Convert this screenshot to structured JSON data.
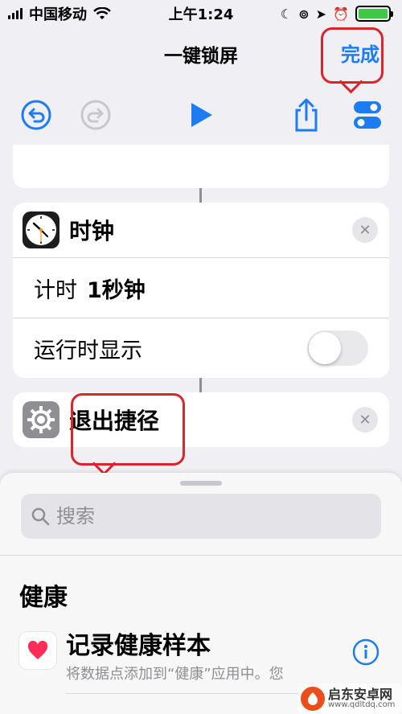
{
  "status_bar": {
    "carrier": "中国移动",
    "time": "上午1:24",
    "battery_level": 1.0
  },
  "nav": {
    "title": "一键锁屏",
    "done_label": "完成"
  },
  "toolbar": {
    "icons": [
      "undo-icon",
      "redo-icon",
      "play-icon",
      "share-icon",
      "settings-toggle-icon"
    ]
  },
  "actions": {
    "clock": {
      "title": "时钟",
      "timer_prefix": "计时",
      "timer_value": "1秒钟",
      "show_when_run_label": "运行时显示",
      "show_when_run": false
    },
    "exit": {
      "title": "退出捷径"
    }
  },
  "sheet": {
    "search_placeholder": "搜索",
    "section_title": "健康",
    "item": {
      "title": "记录健康样本",
      "description": "将数据点添加到“健康”应用中。您"
    }
  },
  "watermark": {
    "name": "启东安卓网",
    "url": "www.qdltdq.com"
  },
  "colors": {
    "accent": "#1d7cf2",
    "annotation": "#d9252c",
    "toggle_off": "#e9e9eb",
    "health_heart": "#ff2d55"
  }
}
